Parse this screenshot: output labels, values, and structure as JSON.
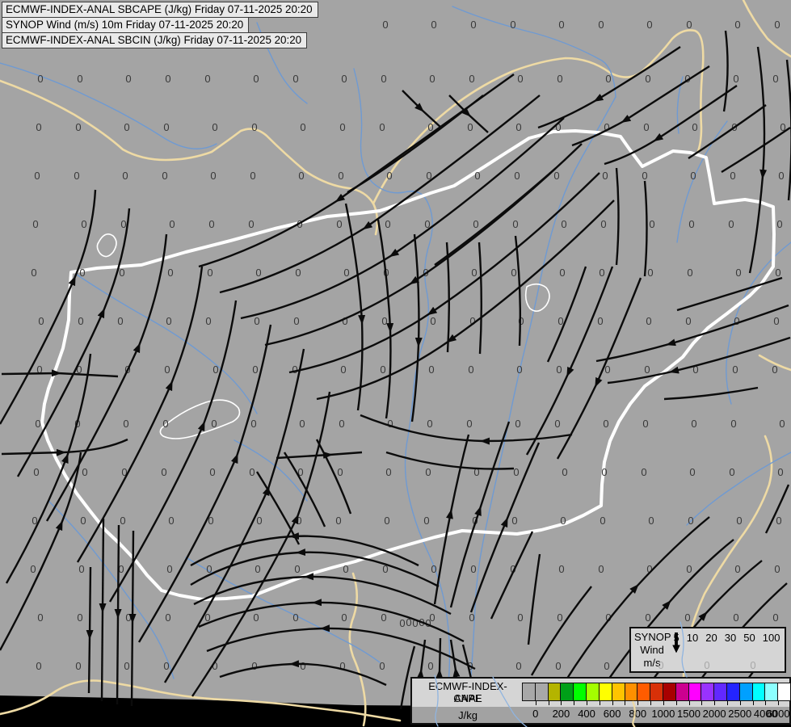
{
  "titles": {
    "line1": "ECMWF-INDEX-ANAL SBCAPE (J/kg) Friday 07-11-2025 20:20",
    "line2": "SYNOP Wind (m/s) 10m Friday 07-11-2025 20:20",
    "line3": "ECMWF-INDEX-ANAL SBCIN (J/kg) Friday 07-11-2025 20:20"
  },
  "wind_legend": {
    "source": "SYNOP",
    "param": "Wind",
    "units": "m/s",
    "arrow_icon": "down-arrow",
    "values": [
      "5",
      "10",
      "20",
      "30",
      "50",
      "100"
    ]
  },
  "cape_legend": {
    "source": "ECMWF-INDEX-ANAL",
    "param": "CAPE",
    "units": "J/kg",
    "tick_labels": [
      "0",
      "200",
      "400",
      "600",
      "800",
      "1000",
      "1500",
      "2000",
      "2500",
      "4000",
      "6000"
    ],
    "label_boundaries": [
      1,
      3,
      5,
      7,
      9,
      11,
      13,
      15,
      17,
      19,
      20
    ],
    "colors": [
      "#a8a8a8",
      "#a8a8a8",
      "#b4b400",
      "#00a018",
      "#00ff00",
      "#a4ff00",
      "#ffff00",
      "#ffc400",
      "#ff9000",
      "#ff5c00",
      "#d83008",
      "#a80000",
      "#cc0090",
      "#ff00ff",
      "#9932ff",
      "#6228ff",
      "#2424ff",
      "#00a0ff",
      "#00ffff",
      "#8cffff",
      "#ffffff"
    ]
  },
  "field_values": {
    "value": "0",
    "grid": {
      "col_start": 46,
      "col_step": 54,
      "col_count": 18,
      "row_start": 33,
      "row_step": 61,
      "row_count": 14
    },
    "cluster_positions": [
      [
        498,
        771
      ],
      [
        506,
        770
      ],
      [
        514,
        771
      ],
      [
        522,
        770
      ],
      [
        530,
        771
      ]
    ],
    "light_positions": [
      [
        818,
        823
      ],
      [
        875,
        823
      ],
      [
        932,
        823
      ]
    ],
    "dark_color": "#383838",
    "light_color": "#a8a8a8"
  },
  "colors": {
    "map_bg": "#a4a4a4",
    "no_data_black": "#000000",
    "country_border_white": "#ffffff",
    "neighbor_border_tan": "#eedaa4",
    "river_blue": "#6f9ad2",
    "streamline_black": "#0b0b0b"
  }
}
